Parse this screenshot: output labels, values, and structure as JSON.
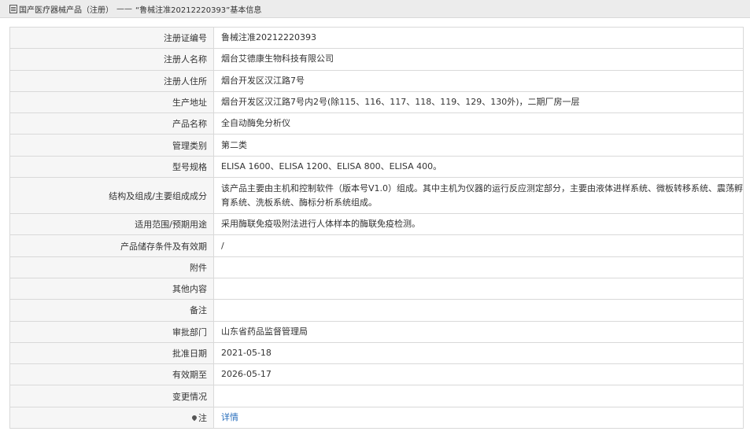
{
  "breadcrumb": {
    "category": "国产医疗器械产品（注册）",
    "separator": "——",
    "item": "“鲁械注准20212220393”",
    "suffix": "基本信息"
  },
  "rows": [
    {
      "label": "注册证编号",
      "value": "鲁械注准20212220393"
    },
    {
      "label": "注册人名称",
      "value": "烟台艾德康生物科技有限公司"
    },
    {
      "label": "注册人住所",
      "value": "烟台开发区汉江路7号"
    },
    {
      "label": "生产地址",
      "value": "烟台开发区汉江路7号内2号(除115、116、117、118、119、129、130外)，二期厂房一层"
    },
    {
      "label": "产品名称",
      "value": "全自动酶免分析仪"
    },
    {
      "label": "管理类别",
      "value": "第二类"
    },
    {
      "label": "型号规格",
      "value": "ELISA 1600、ELISA 1200、ELISA 800、ELISA 400。"
    },
    {
      "label": "结构及组成/主要组成成分",
      "value": "该产品主要由主机和控制软件（版本号V1.0）组成。其中主机为仪器的运行反应测定部分，主要由液体进样系统、微板转移系统、震荡孵育系统、洗板系统、酶标分析系统组成。"
    },
    {
      "label": "适用范围/预期用途",
      "value": "采用酶联免疫吸附法进行人体样本的酶联免疫检测。"
    },
    {
      "label": "产品储存条件及有效期",
      "value": "/"
    },
    {
      "label": "附件",
      "value": ""
    },
    {
      "label": "其他内容",
      "value": ""
    },
    {
      "label": "备注",
      "value": ""
    },
    {
      "label": "审批部门",
      "value": "山东省药品监督管理局"
    },
    {
      "label": "批准日期",
      "value": "2021-05-18"
    },
    {
      "label": "有效期至",
      "value": "2026-05-17"
    },
    {
      "label": "变更情况",
      "value": ""
    }
  ],
  "note": {
    "label": "注",
    "link": "详情"
  }
}
